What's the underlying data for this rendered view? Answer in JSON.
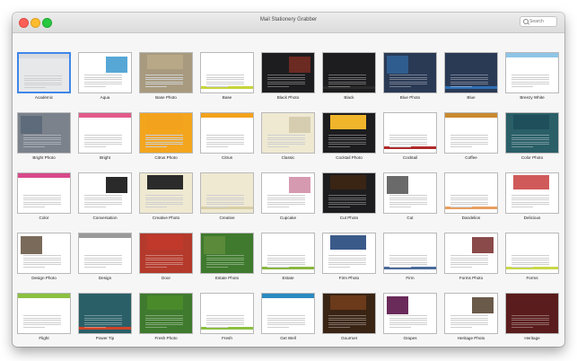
{
  "window": {
    "title": "Mail Stationery Grabber"
  },
  "search": {
    "placeholder": "Search",
    "value": ""
  },
  "accent_selection_color": "#3f86e8",
  "selected_index": 0,
  "templates": [
    {
      "name": "Academic",
      "theme": "light-gray",
      "accent": "#d9dbe0",
      "photo": false
    },
    {
      "name": "Aqua",
      "theme": "white",
      "accent": "#57a7d6",
      "photo": true
    },
    {
      "name": "Base Photo",
      "theme": "wood",
      "accent": "#b9a888",
      "photo": true
    },
    {
      "name": "Base",
      "theme": "white",
      "accent": "#c7d43a",
      "photo": false
    },
    {
      "name": "Black Photo",
      "theme": "dark",
      "accent": "#6b2a22",
      "photo": true
    },
    {
      "name": "Black",
      "theme": "dark",
      "accent": "#2b2b2b",
      "photo": false
    },
    {
      "name": "Blue Photo",
      "theme": "navy",
      "accent": "#2f5d8f",
      "photo": true
    },
    {
      "name": "Blue",
      "theme": "navy",
      "accent": "#2f6fb3",
      "photo": false
    },
    {
      "name": "Breezy White",
      "theme": "white",
      "accent": "#8ec5e6",
      "photo": false
    },
    {
      "name": "Bright Photo",
      "theme": "gray",
      "accent": "#5e6b7a",
      "photo": true
    },
    {
      "name": "Bright",
      "theme": "white",
      "accent": "#e25a8a",
      "photo": false
    },
    {
      "name": "Citrus Photo",
      "theme": "orange",
      "accent": "#f2a21c",
      "photo": true
    },
    {
      "name": "Citrus",
      "theme": "white",
      "accent": "#f2a21c",
      "photo": false
    },
    {
      "name": "Classic",
      "theme": "cream",
      "accent": "#d6cdb0",
      "photo": true
    },
    {
      "name": "Cocktail Photo",
      "theme": "dark",
      "accent": "#f0b52a",
      "photo": true
    },
    {
      "name": "Cocktail",
      "theme": "white",
      "accent": "#b02a2a",
      "photo": false
    },
    {
      "name": "Coffee",
      "theme": "white",
      "accent": "#c98a2e",
      "photo": false
    },
    {
      "name": "Color Photo",
      "theme": "teal",
      "accent": "#1e4f5a",
      "photo": true
    },
    {
      "name": "Color",
      "theme": "white",
      "accent": "#d84a8a",
      "photo": false
    },
    {
      "name": "Conversation",
      "theme": "white",
      "accent": "#2a2a2a",
      "photo": true
    },
    {
      "name": "Creative Photo",
      "theme": "cream",
      "accent": "#2b2b2b",
      "photo": true
    },
    {
      "name": "Creative",
      "theme": "cream",
      "accent": "#d8cfa8",
      "photo": false
    },
    {
      "name": "Cupcake",
      "theme": "white",
      "accent": "#d69ab0",
      "photo": true
    },
    {
      "name": "Cut Photo",
      "theme": "dark",
      "accent": "#3a2414",
      "photo": true
    },
    {
      "name": "Cut",
      "theme": "white",
      "accent": "#6a6a6a",
      "photo": true
    },
    {
      "name": "Dandelion",
      "theme": "white",
      "accent": "#e8a060",
      "photo": false
    },
    {
      "name": "Delicious",
      "theme": "white",
      "accent": "#d05a5a",
      "photo": true
    },
    {
      "name": "Design Photo",
      "theme": "white",
      "accent": "#7a6a5a",
      "photo": true
    },
    {
      "name": "Design",
      "theme": "white",
      "accent": "#9a9a9a",
      "photo": false
    },
    {
      "name": "Door",
      "theme": "red",
      "accent": "#c0392b",
      "photo": true
    },
    {
      "name": "Estate Photo",
      "theme": "green",
      "accent": "#5a8a3a",
      "photo": true
    },
    {
      "name": "Estate",
      "theme": "white",
      "accent": "#8ab640",
      "photo": false
    },
    {
      "name": "Firm Photo",
      "theme": "white",
      "accent": "#3a5a8a",
      "photo": true
    },
    {
      "name": "Firm",
      "theme": "white",
      "accent": "#4a6a9a",
      "photo": false
    },
    {
      "name": "Forms Photo",
      "theme": "white",
      "accent": "#8a4a4a",
      "photo": true
    },
    {
      "name": "Forms",
      "theme": "white",
      "accent": "#c8d84a",
      "photo": false
    },
    {
      "name": "Flight",
      "theme": "white",
      "accent": "#8ac040",
      "photo": false
    },
    {
      "name": "Power Tip",
      "theme": "teal",
      "accent": "#d0442a",
      "photo": false
    },
    {
      "name": "Fresh Photo",
      "theme": "green",
      "accent": "#4a8a2a",
      "photo": true
    },
    {
      "name": "Fresh",
      "theme": "white",
      "accent": "#8ac040",
      "photo": false
    },
    {
      "name": "Get Well",
      "theme": "white",
      "accent": "#2a8ac0",
      "photo": false
    },
    {
      "name": "Gourmet",
      "theme": "brown",
      "accent": "#6a3a1a",
      "photo": true
    },
    {
      "name": "Grapes",
      "theme": "white",
      "accent": "#6a2a5a",
      "photo": true
    },
    {
      "name": "Heritage Photo",
      "theme": "white",
      "accent": "#6a5a4a",
      "photo": true
    },
    {
      "name": "Heritage",
      "theme": "maroon",
      "accent": "#5a1a1a",
      "photo": false
    }
  ]
}
